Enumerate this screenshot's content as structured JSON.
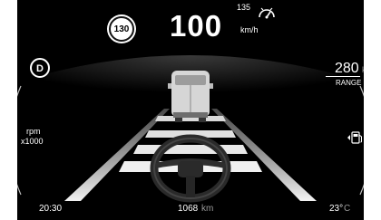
{
  "speed_limit": "130",
  "speed": {
    "value": "100",
    "unit": "km/h"
  },
  "cruise": {
    "set_speed": "135",
    "icon": "cruise-control-icon"
  },
  "gear": "D",
  "range": {
    "value": "280",
    "unit": "km",
    "label": "RANGE"
  },
  "tachometer": {
    "unit_line1": "rpm",
    "unit_line2": "x1000"
  },
  "fuel": {
    "icon": "fuel-pump-icon"
  },
  "status_bar": {
    "time": "20:30",
    "odometer": "1068",
    "odometer_unit": "km",
    "temperature": "23°",
    "temperature_unit": "C"
  },
  "colors": {
    "background": "#000000",
    "text": "#ffffff",
    "lane": "#e6e6e6",
    "unit_gray": "#9a9a9a"
  },
  "icons": {
    "steering": "steering-wheel-icon",
    "vehicle": "van-ahead-icon"
  }
}
